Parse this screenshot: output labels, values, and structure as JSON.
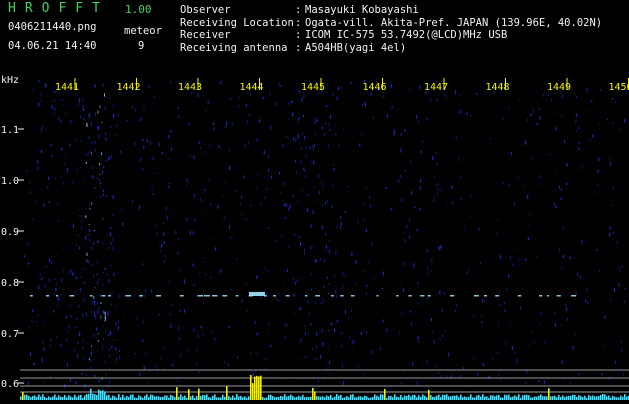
{
  "header": {
    "app_name": "HROFFT",
    "app_version": "1.00",
    "file_name": "0406211440.png",
    "timestamp": "04.06.21 14:40",
    "meteor_label": "meteor",
    "meteor_count": "9"
  },
  "station_info": [
    {
      "label": "Observer",
      "sep": ":",
      "value": "Masayuki Kobayashi"
    },
    {
      "label": "Receiving Location",
      "sep": ":",
      "value": "Ogata-vill. Akita-Pref. JAPAN (139.96E, 40.02N)"
    },
    {
      "label": "Receiver",
      "sep": ":",
      "value": "ICOM IC-575 53.7492(@LCD)MHz USB"
    },
    {
      "label": "Receiving antenna",
      "sep": ":",
      "value": "A504HB(yagi 4el)"
    }
  ],
  "spectrogram": {
    "y_unit": "kHz",
    "y_ticks": [
      "1.1",
      "1.0",
      "0.9",
      "0.8",
      "0.7",
      "0.6"
    ],
    "time_ticks": [
      "1441",
      "1442",
      "1443",
      "1444",
      "1445",
      "1446",
      "1447",
      "1448",
      "1449",
      "1450"
    ],
    "colors": {
      "background": "#000000",
      "noise": "#1a3aff",
      "signal": "#9fe8ff",
      "tick": "#f4f400",
      "level": "#40e0ff",
      "level_peak": "#f4f400"
    }
  }
}
